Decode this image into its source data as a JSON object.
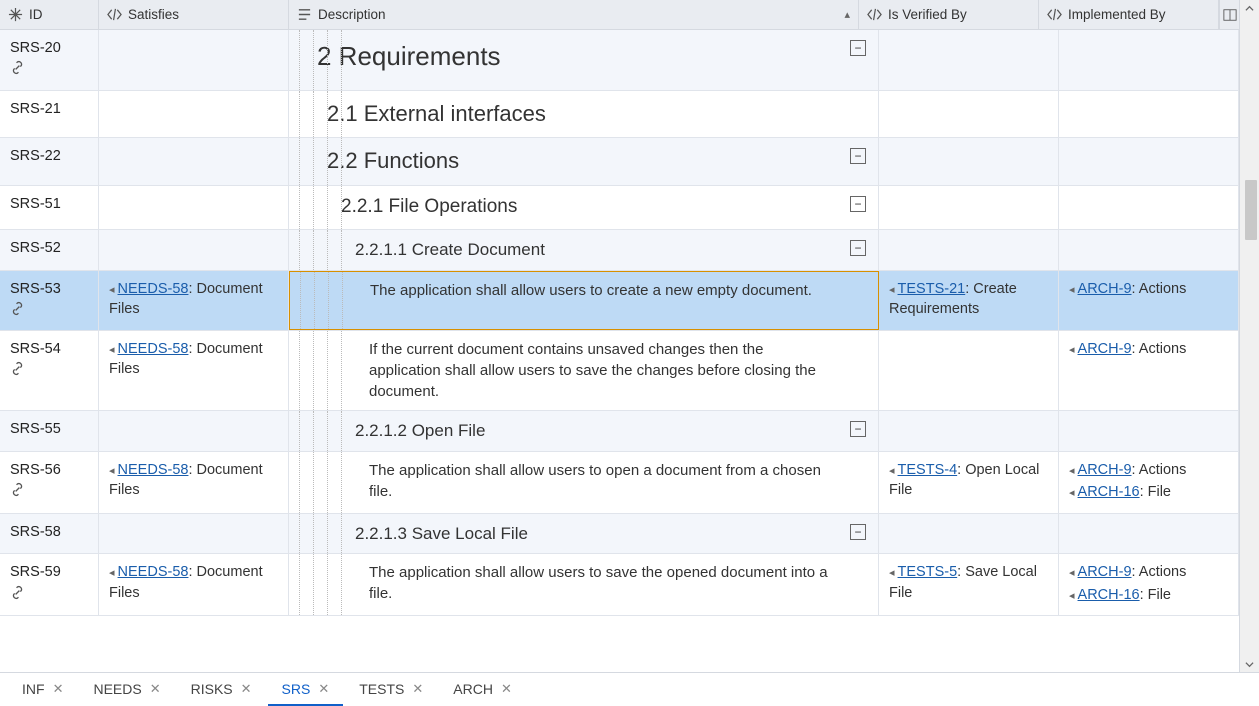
{
  "columns": {
    "id": "ID",
    "satisfies": "Satisfies",
    "description": "Description",
    "verified": "Is Verified By",
    "implemented": "Implemented By"
  },
  "rows": [
    {
      "id": "SRS-20",
      "hasLink": true,
      "alt": true,
      "level": "h1",
      "desc": "2 Requirements",
      "collapse": true,
      "satisfies": [],
      "verified": [],
      "implemented": []
    },
    {
      "id": "SRS-21",
      "hasLink": false,
      "alt": false,
      "level": "h2",
      "desc": "2.1 External interfaces",
      "collapse": false,
      "satisfies": [],
      "verified": [],
      "implemented": []
    },
    {
      "id": "SRS-22",
      "hasLink": false,
      "alt": true,
      "level": "h2",
      "desc": "2.2 Functions",
      "collapse": true,
      "satisfies": [],
      "verified": [],
      "implemented": []
    },
    {
      "id": "SRS-51",
      "hasLink": false,
      "alt": false,
      "level": "h3",
      "desc": "2.2.1 File Operations",
      "collapse": true,
      "satisfies": [],
      "verified": [],
      "implemented": []
    },
    {
      "id": "SRS-52",
      "hasLink": false,
      "alt": true,
      "level": "h4",
      "desc": "2.2.1.1 Create Document",
      "collapse": true,
      "satisfies": [],
      "verified": [],
      "implemented": []
    },
    {
      "id": "SRS-53",
      "hasLink": true,
      "selected": true,
      "level": "body",
      "desc": "The application shall allow users to create a new empty document.",
      "satisfies": [
        {
          "ref": "NEEDS-58",
          "text": ": Document Files"
        }
      ],
      "verified": [
        {
          "ref": "TESTS-21",
          "text": ": Create Requirements"
        }
      ],
      "implemented": [
        {
          "ref": "ARCH-9",
          "text": ": Actions"
        }
      ]
    },
    {
      "id": "SRS-54",
      "hasLink": true,
      "alt": false,
      "level": "body",
      "desc": "If the current document contains unsaved changes then the application shall allow users to save the changes before closing the document.",
      "satisfies": [
        {
          "ref": "NEEDS-58",
          "text": ": Document Files"
        }
      ],
      "verified": [],
      "implemented": [
        {
          "ref": "ARCH-9",
          "text": ": Actions"
        }
      ]
    },
    {
      "id": "SRS-55",
      "hasLink": false,
      "alt": true,
      "level": "h4",
      "desc": "2.2.1.2 Open File",
      "collapse": true,
      "satisfies": [],
      "verified": [],
      "implemented": []
    },
    {
      "id": "SRS-56",
      "hasLink": true,
      "alt": false,
      "level": "body",
      "desc": "The application shall allow users to open a document from a chosen file.",
      "satisfies": [
        {
          "ref": "NEEDS-58",
          "text": ": Document Files"
        }
      ],
      "verified": [
        {
          "ref": "TESTS-4",
          "text": ": Open Local File"
        }
      ],
      "implemented": [
        {
          "ref": "ARCH-9",
          "text": ": Actions"
        },
        {
          "ref": "ARCH-16",
          "text": ": File"
        }
      ]
    },
    {
      "id": "SRS-58",
      "hasLink": false,
      "alt": true,
      "level": "h4",
      "desc": "2.2.1.3 Save Local File",
      "collapse": true,
      "satisfies": [],
      "verified": [],
      "implemented": []
    },
    {
      "id": "SRS-59",
      "hasLink": true,
      "alt": false,
      "level": "body",
      "desc": "The application shall allow users to save the opened document into a file.",
      "satisfies": [
        {
          "ref": "NEEDS-58",
          "text": ": Document Files"
        }
      ],
      "verified": [
        {
          "ref": "TESTS-5",
          "text": ": Save Local File"
        }
      ],
      "implemented": [
        {
          "ref": "ARCH-9",
          "text": ": Actions"
        },
        {
          "ref": "ARCH-16",
          "text": ": File"
        }
      ]
    }
  ],
  "tabs": [
    {
      "label": "INF",
      "active": false
    },
    {
      "label": "NEEDS",
      "active": false
    },
    {
      "label": "RISKS",
      "active": false
    },
    {
      "label": "SRS",
      "active": true
    },
    {
      "label": "TESTS",
      "active": false
    },
    {
      "label": "ARCH",
      "active": false
    }
  ]
}
